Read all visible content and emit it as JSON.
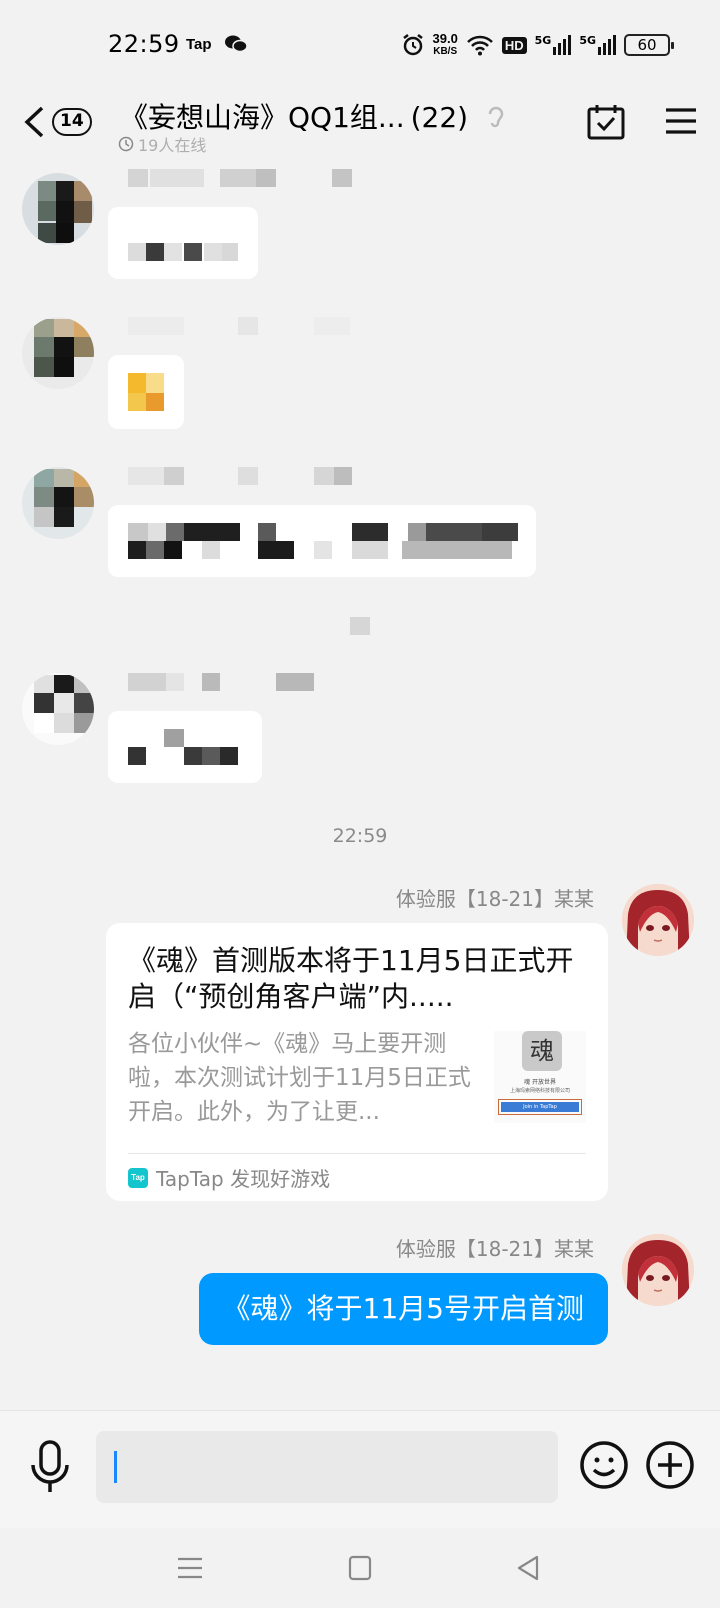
{
  "status_bar": {
    "time": "22:59",
    "tap_app": "Tap",
    "net_speed_value": "39.0",
    "net_speed_unit": "KB/S",
    "hd_label": "HD",
    "sim1": "5G",
    "sim2": "5G",
    "battery": "60"
  },
  "header": {
    "unread_count": "14",
    "title": "《妄想山海》QQ1组...",
    "member_count": "(22)",
    "online_text": "19人在线"
  },
  "messages": {
    "timestamp": "22:59",
    "card_message": {
      "sender": "体验服【18-21】某某",
      "title": "《魂》首测版本将于11月5日正式开启（“预创角客户端”内.....",
      "description": "各位小伙伴~《魂》马上要开测啦，本次测试计划于11月5日正式开启。此外，为了让更...",
      "source_logo": "Tap",
      "source": "TapTap 发现好游戏",
      "thumb_title": "魂",
      "thumb_caption": "魂 开放世界",
      "thumb_company": "上海玛索网络科技有限公司",
      "thumb_button": "Join in TapTap"
    },
    "text_message": {
      "sender": "体验服【18-21】某某",
      "text": "《魂》将于11月5号开启首测"
    }
  },
  "colors": {
    "outgoing_bubble": "#0099ff",
    "background": "#f2f2f2",
    "taptap_brand": "#15c5ce",
    "caret": "#1a88ff"
  },
  "icons": [
    "back-icon",
    "calendar-check-icon",
    "menu-icon",
    "microphone-icon",
    "emoji-icon",
    "plus-icon",
    "nav-menu-icon",
    "nav-home-icon",
    "nav-back-icon",
    "alarm-icon",
    "wifi-icon",
    "wechat-icon"
  ]
}
